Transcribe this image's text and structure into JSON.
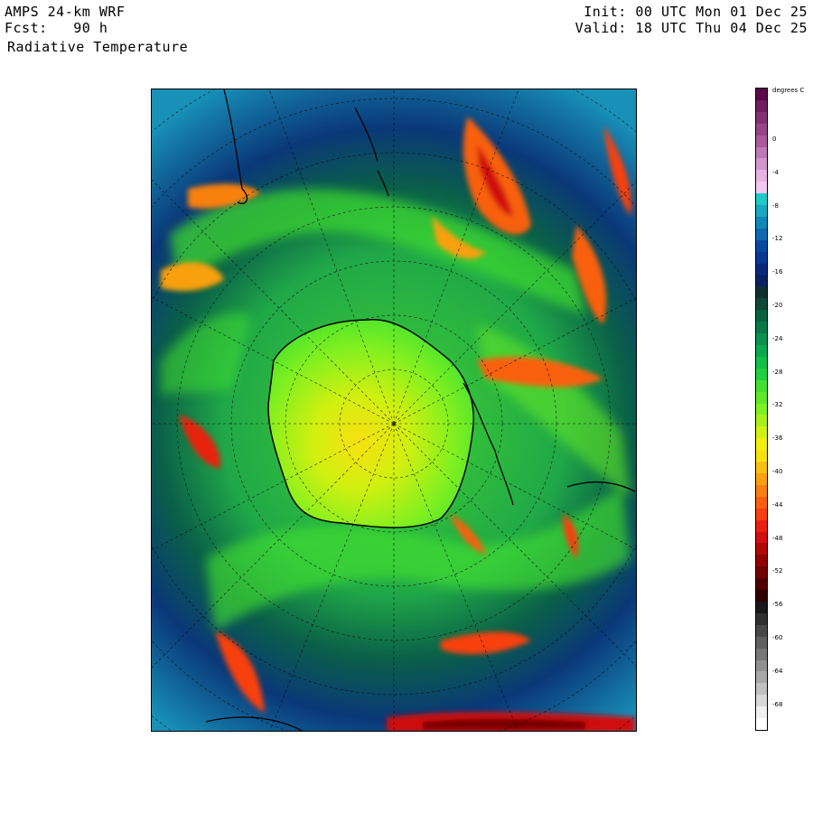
{
  "header": {
    "model": "AMPS 24-km WRF",
    "forecast": "Fcst:   90 h",
    "field": "Radiative Temperature",
    "init": "Init: 00 UTC Mon 01 Dec 25",
    "valid": "Valid: 18 UTC Thu 04 Dec 25"
  },
  "colorbar": {
    "units": "degrees C",
    "labels": [
      "0",
      "-4",
      "-8",
      "-12",
      "-16",
      "-20",
      "-24",
      "-28",
      "-32",
      "-36",
      "-40",
      "-44",
      "-48",
      "-52",
      "-56",
      "-60",
      "-64",
      "-68"
    ],
    "colors": [
      "#5a0a4a",
      "#6e1e5e",
      "#823272",
      "#964686",
      "#aa5a9a",
      "#be78b4",
      "#d296cc",
      "#e6b4e2",
      "#f0c8f0",
      "#20c8c8",
      "#18a8c0",
      "#1088b8",
      "#1068b0",
      "#0848a0",
      "#083890",
      "#0a2878",
      "#0a2060",
      "#103030",
      "#104838",
      "#086040",
      "#087848",
      "#0a9050",
      "#0aa850",
      "#10c048",
      "#20d040",
      "#40e030",
      "#60e828",
      "#80f020",
      "#a8f018",
      "#d0f010",
      "#f0f010",
      "#f8e010",
      "#f8c010",
      "#f8a010",
      "#f88010",
      "#f86010",
      "#f84010",
      "#e82010",
      "#d01010",
      "#b00808",
      "#900404",
      "#700202",
      "#500000",
      "#300000",
      "#181818",
      "#303030",
      "#484848",
      "#606060",
      "#787878",
      "#909090",
      "#a8a8a8",
      "#c0c0c0",
      "#d8d8d8",
      "#f0f0f0",
      "#ffffff"
    ]
  },
  "map": {
    "projection": "polar stereographic",
    "center": "South Pole",
    "features": [
      "coastline-antarctica",
      "coastline-australia",
      "coastline-new-zealand",
      "coastline-south-america",
      "graticule"
    ]
  }
}
